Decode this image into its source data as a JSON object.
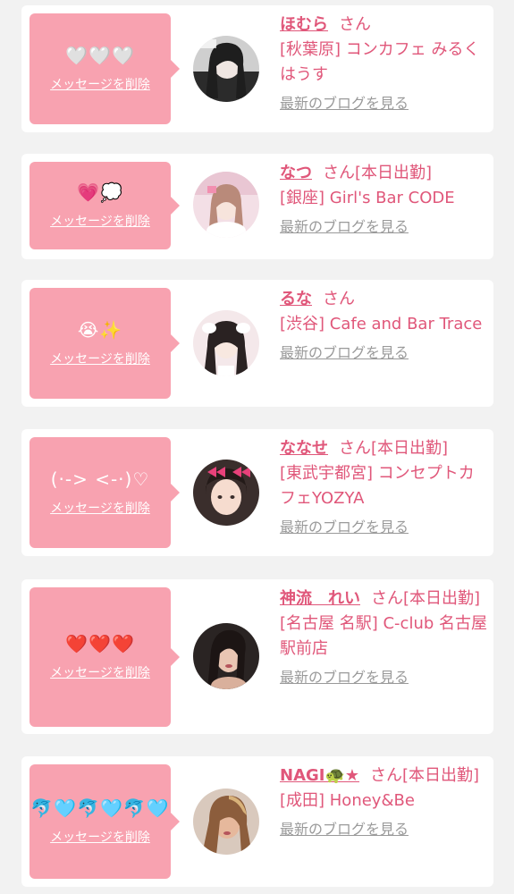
{
  "colors": {
    "accent": "#e0577a",
    "bubble": "#f8a2b0",
    "link_gray": "#9a9a9a",
    "background": "#f2f2f2"
  },
  "delete_label": "メッセージを削除",
  "blog_label": "最新のブログを見る",
  "items": [
    {
      "message": "🤍🤍🤍",
      "avatar_icon": "avatar-photo",
      "name": "ほむら",
      "suffix": "さん",
      "shop": "[秋葉原] コンカフェ みるくはうす"
    },
    {
      "message": "💗💭",
      "avatar_icon": "avatar-photo",
      "name": "なつ",
      "suffix": "さん[本日出勤]",
      "shop": "[銀座] Girl's Bar CODE"
    },
    {
      "message": "😭✨",
      "avatar_icon": "avatar-photo",
      "name": "るな",
      "suffix": "さん",
      "shop": "[渋谷] Cafe and Bar Trace"
    },
    {
      "message": "(·-> <-·)♡",
      "avatar_icon": "avatar-photo",
      "name": "ななせ",
      "suffix": "さん[本日出勤]",
      "shop": "[東武宇都宮] コンセプトカフェYOZYA"
    },
    {
      "message": "❤️❤️❤️",
      "avatar_icon": "avatar-photo",
      "name": "神流　れい",
      "suffix": "さん[本日出勤]",
      "shop": "[名古屋 名駅] C-club 名古屋駅前店"
    },
    {
      "message": "🐬🩵🐬🩵🐬🩵",
      "avatar_icon": "avatar-photo",
      "name": "NAGI🐢★",
      "suffix": "さん[本日出勤]",
      "shop": "[成田] Honey&Be"
    }
  ]
}
